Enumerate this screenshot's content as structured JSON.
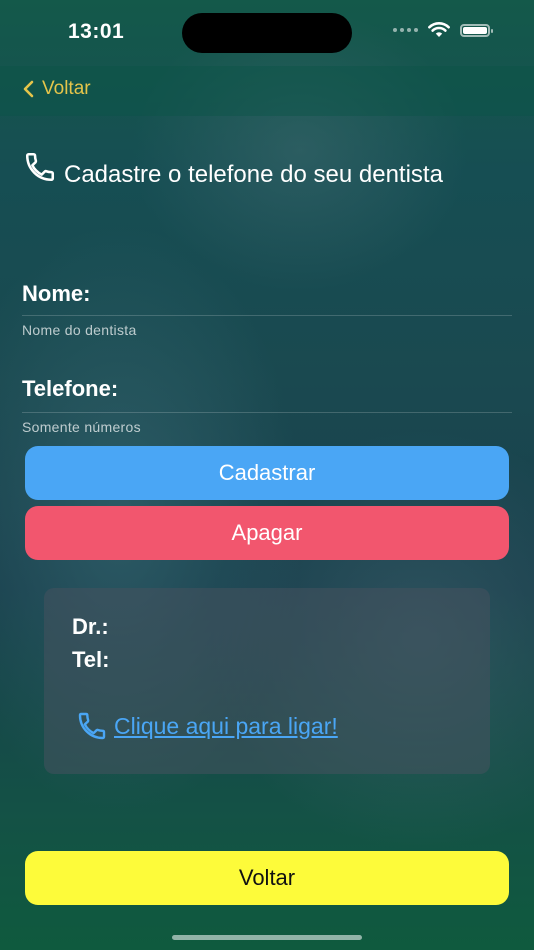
{
  "status_bar": {
    "time": "13:01",
    "icons": [
      "signal-icon",
      "wifi-icon",
      "battery-icon"
    ]
  },
  "nav": {
    "back_label": "Voltar",
    "back_icon": "chevron-left-icon",
    "accent": "#e5c54a"
  },
  "header": {
    "title": "Cadastre o telefone do seu dentista",
    "icon": "phone-icon"
  },
  "form": {
    "name_label": "Nome:",
    "name_value": "",
    "name_placeholder": "Nome do dentista",
    "phone_label": "Telefone:",
    "phone_value": "",
    "phone_placeholder": "Somente números"
  },
  "buttons": {
    "register": {
      "label": "Cadastrar",
      "color": "#4aa6f5"
    },
    "delete": {
      "label": "Apagar",
      "color": "#f2566e"
    },
    "back": {
      "label": "Voltar",
      "color": "#fdfb3a"
    }
  },
  "card": {
    "doctor_label": "Dr.:",
    "phone_label": "Tel:",
    "call_link": "Clique aqui para ligar!",
    "call_icon": "phone-icon"
  }
}
